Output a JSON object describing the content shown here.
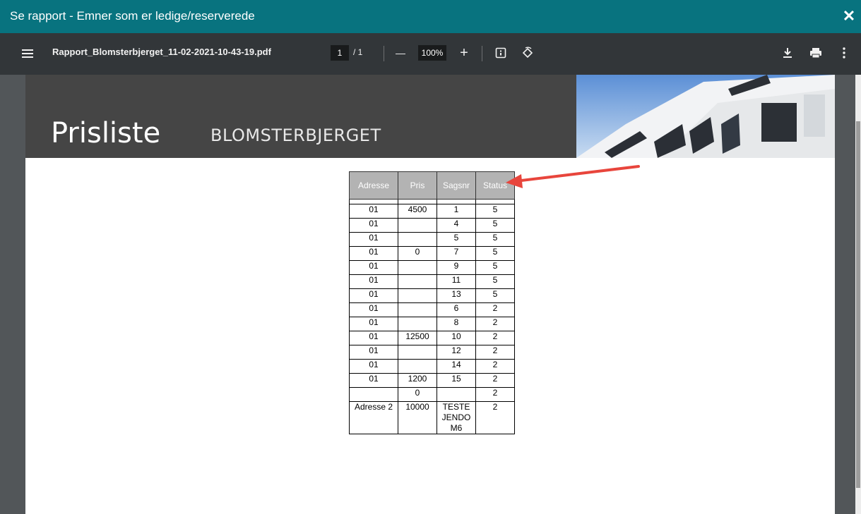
{
  "window": {
    "title": "Se rapport - Emner som er ledige/reserverede",
    "close_glyph": "✕"
  },
  "toolbar": {
    "filename": "Rapport_Blomsterbjerget_11-02-2021-10-43-19.pdf",
    "page_current": "1",
    "page_total": "/ 1",
    "zoom": "100%",
    "zoom_out": "—",
    "zoom_in": "+"
  },
  "document": {
    "title": "Prisliste",
    "subtitle": "BLOMSTERBJERGET"
  },
  "table": {
    "headers": [
      "Adresse",
      "Pris",
      "Sagsnr",
      "Status"
    ],
    "rows": [
      [
        "01",
        "4500",
        "1",
        "5"
      ],
      [
        "01",
        "",
        "4",
        "5"
      ],
      [
        "01",
        "",
        "5",
        "5"
      ],
      [
        "01",
        "0",
        "7",
        "5"
      ],
      [
        "01",
        "",
        "9",
        "5"
      ],
      [
        "01",
        "",
        "11",
        "5"
      ],
      [
        "01",
        "",
        "13",
        "5"
      ],
      [
        "01",
        "",
        "6",
        "2"
      ],
      [
        "01",
        "",
        "8",
        "2"
      ],
      [
        "01",
        "12500",
        "10",
        "2"
      ],
      [
        "01",
        "",
        "12",
        "2"
      ],
      [
        "01",
        "",
        "14",
        "2"
      ],
      [
        "01",
        "1200",
        "15",
        "2"
      ],
      [
        "",
        "0",
        "",
        "2"
      ],
      [
        "Adresse 2",
        "10000",
        "TESTE JENDO M6",
        "2"
      ]
    ]
  },
  "colors": {
    "titlebar": "#08737f",
    "toolbar": "#323639",
    "viewer": "#525659",
    "annotation_arrow": "#e8453c"
  }
}
